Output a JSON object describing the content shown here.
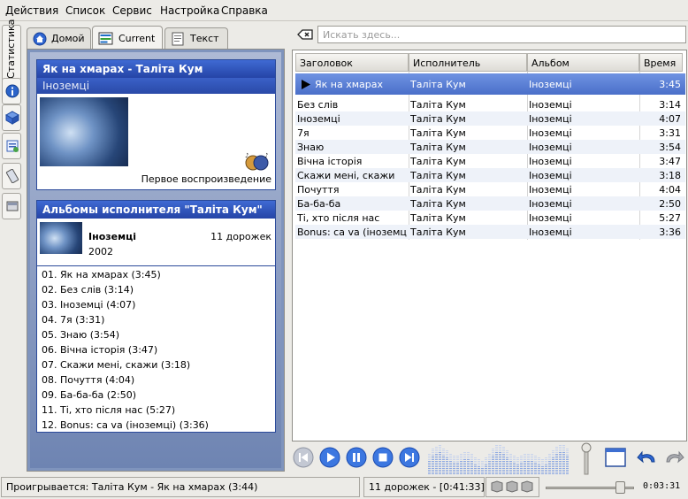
{
  "menu": [
    "Действия",
    "Список",
    "Сервис",
    "Настройка",
    "Справка"
  ],
  "left_toolbar": {
    "stats_label": "Статистика"
  },
  "tabs": [
    {
      "label": "Домой",
      "icon": "home-icon"
    },
    {
      "label": "Current",
      "icon": "current-icon"
    },
    {
      "label": "Текст",
      "icon": "lyrics-icon"
    }
  ],
  "context": {
    "now": {
      "title": "Як на хмарах - Таліта Кум",
      "album": "Іноземці",
      "first_play": "Первое воспроизведение"
    },
    "albums": {
      "header": "Альбомы исполнителя \"Таліта Кум\"",
      "album_name": "Іноземці",
      "year": "2002",
      "track_count": "11 дорожек",
      "tracks": [
        "01. Як на хмарах (3:45)",
        "02. Без слів (3:14)",
        "03. Іноземці (4:07)",
        "04. 7я (3:31)",
        "05. Знаю (3:54)",
        "06. Вічна історія (3:47)",
        "07. Скажи мені, скажи (3:18)",
        "08. Почуття (4:04)",
        "09. Ба-ба-ба (2:50)",
        "11. Ті, хто після нас (5:27)",
        "12. Bonus: ca va (іноземці) (3:36)"
      ]
    }
  },
  "search": {
    "placeholder": "Искать здесь..."
  },
  "playlist": {
    "columns": [
      "Заголовок",
      "Исполнитель",
      "Альбом",
      "Время"
    ],
    "rows": [
      {
        "title": "Як на хмарах",
        "artist": "Таліта Кум",
        "album": "Іноземці",
        "time": "3:45"
      },
      {
        "title": "Без слів",
        "artist": "Таліта Кум",
        "album": "Іноземці",
        "time": "3:14"
      },
      {
        "title": "Іноземці",
        "artist": "Таліта Кум",
        "album": "Іноземці",
        "time": "4:07"
      },
      {
        "title": "7я",
        "artist": "Таліта Кум",
        "album": "Іноземці",
        "time": "3:31"
      },
      {
        "title": "Знаю",
        "artist": "Таліта Кум",
        "album": "Іноземці",
        "time": "3:54"
      },
      {
        "title": "Вічна історія",
        "artist": "Таліта Кум",
        "album": "Іноземці",
        "time": "3:47"
      },
      {
        "title": "Скажи мені, скажи",
        "artist": "Таліта Кум",
        "album": "Іноземці",
        "time": "3:18"
      },
      {
        "title": "Почуття",
        "artist": "Таліта Кум",
        "album": "Іноземці",
        "time": "4:04"
      },
      {
        "title": "Ба-ба-ба",
        "artist": "Таліта Кум",
        "album": "Іноземці",
        "time": "2:50"
      },
      {
        "title": "Ті, хто після нас",
        "artist": "Таліта Кум",
        "album": "Іноземці",
        "time": "5:27"
      },
      {
        "title": "Bonus: ca va (іноземці)",
        "artist": "Таліта Кум",
        "album": "Іноземці",
        "time": "3:36"
      }
    ]
  },
  "status": {
    "playing": "Проигрывается: Таліта Кум - Як на хмарах (3:44)",
    "tracks_total": "11 дорожек - [0:41:33]",
    "elapsed": "0:03:31",
    "position_fraction": 0.85
  },
  "colors": {
    "accent": "#2e52b8",
    "selection": "#5a7fd6",
    "panel_bg": "#8aa0c8"
  }
}
